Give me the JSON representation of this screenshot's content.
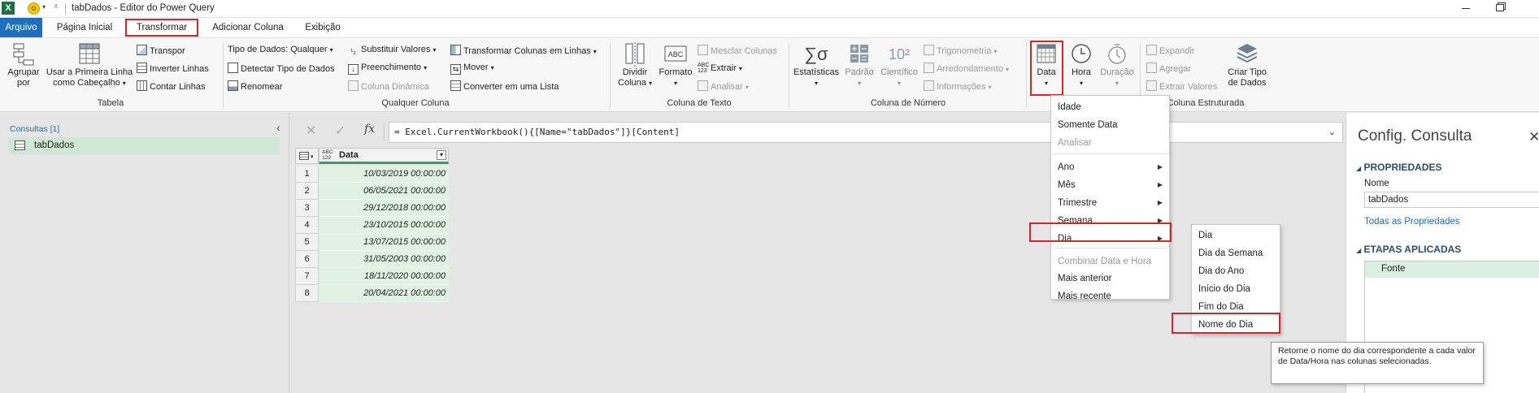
{
  "title_bar": {
    "title": "tabDados - Editor do Power Query",
    "logo_letter": "X"
  },
  "tabs": {
    "file": "Arquivo",
    "home": "Página Inicial",
    "transform": "Transformar",
    "add_column": "Adicionar Coluna",
    "view": "Exibição"
  },
  "ribbon": {
    "tabela": {
      "group": "Tabela",
      "group_by": [
        "Agrupar",
        "por"
      ],
      "first_row": [
        "Usar a Primeira Linha",
        "como Cabeçalho"
      ],
      "transpose": "Transpor",
      "reverse_rows": "Inverter Linhas",
      "count_rows": "Contar Linhas"
    },
    "qualquer_coluna": {
      "group": "Qualquer Coluna",
      "data_type": "Tipo de Dados: Qualquer",
      "detect_type": "Detectar Tipo de Dados",
      "rename": "Renomear",
      "replace_values": "Substituir Valores",
      "fill": "Preenchimento",
      "pivot": "Coluna Dinâmica",
      "unpivot": "Transformar Colunas em Linhas",
      "move": "Mover",
      "to_list": "Converter em uma Lista"
    },
    "coluna_texto": {
      "group": "Coluna de Texto",
      "split": [
        "Dividir",
        "Coluna"
      ],
      "format": "Formato",
      "merge": "Mesclar Colunas",
      "extract": "Extrair",
      "parse": "Analisar"
    },
    "coluna_numero": {
      "group": "Coluna de Número",
      "statistics": "Estatísticas",
      "standard": "Padrão",
      "scientific": "Científico",
      "scientific_glyph": "10²",
      "trig": "Trigonometria",
      "rounding": "Arredondamento",
      "info": "Informações"
    },
    "data_hora": {
      "date": "Data",
      "time": "Hora",
      "duration": "Duração"
    },
    "coluna_estruturada": {
      "group": "Coluna Estruturada",
      "expand": "Expandir",
      "aggregate": "Agregar",
      "extract_values": "Extrair Valores",
      "create_type": [
        "Criar Tipo",
        "de Dados"
      ]
    }
  },
  "queries_pane": {
    "header": "Consultas [1]",
    "items": [
      "tabDados"
    ]
  },
  "formula_bar": {
    "formula": "= Excel.CurrentWorkbook(){[Name=\"tabDados\"]}[Content]",
    "fx": "fx"
  },
  "grid": {
    "type_glyph": "ABC\n123",
    "column_header": "Data",
    "rows": [
      {
        "n": "1",
        "value": "10/03/2019 00:00:00"
      },
      {
        "n": "2",
        "value": "06/05/2021 00:00:00"
      },
      {
        "n": "3",
        "value": "29/12/2018 00:00:00"
      },
      {
        "n": "4",
        "value": "23/10/2015 00:00:00"
      },
      {
        "n": "5",
        "value": "13/07/2015 00:00:00"
      },
      {
        "n": "6",
        "value": "31/05/2003 00:00:00"
      },
      {
        "n": "7",
        "value": "18/11/2020 00:00:00"
      },
      {
        "n": "8",
        "value": "20/04/2021 00:00:00"
      }
    ]
  },
  "date_menu": {
    "items": [
      {
        "label": "Idade",
        "disabled": false,
        "submenu": false
      },
      {
        "label": "Somente Data",
        "disabled": false,
        "submenu": false
      },
      {
        "label": "Analisar",
        "disabled": true,
        "submenu": false
      },
      {
        "label": "Ano",
        "disabled": false,
        "submenu": true
      },
      {
        "label": "Mês",
        "disabled": false,
        "submenu": true
      },
      {
        "label": "Trimestre",
        "disabled": false,
        "submenu": true
      },
      {
        "label": "Semana",
        "disabled": false,
        "submenu": true
      },
      {
        "label": "Dia",
        "disabled": false,
        "submenu": true
      },
      {
        "label": "Combinar Data e Hora",
        "disabled": true,
        "submenu": false
      },
      {
        "label": "Mais anterior",
        "disabled": false,
        "submenu": false
      },
      {
        "label": "Mais recente",
        "disabled": false,
        "submenu": false
      }
    ]
  },
  "day_submenu": {
    "items": [
      "Dia",
      "Dia da Semana",
      "Dia do Ano",
      "Início do Dia",
      "Fim do Dia",
      "Nome do Dia"
    ]
  },
  "tooltip": {
    "text": "Retorne o nome do dia correspondente a cada valor de Data/Hora nas colunas selecionadas."
  },
  "settings_pane": {
    "title": "Config. Consulta",
    "properties_header": "PROPRIEDADES",
    "name_label": "Nome",
    "name_value": "tabDados",
    "all_properties": "Todas as Propriedades",
    "steps_header": "ETAPAS APLICADAS",
    "steps": [
      "Fonte"
    ]
  },
  "colors": {
    "accent": "#1e6fbd",
    "highlight_box": "#d4242c",
    "grid_fill": "#dff2e3",
    "step_fill": "#d9efdf"
  }
}
